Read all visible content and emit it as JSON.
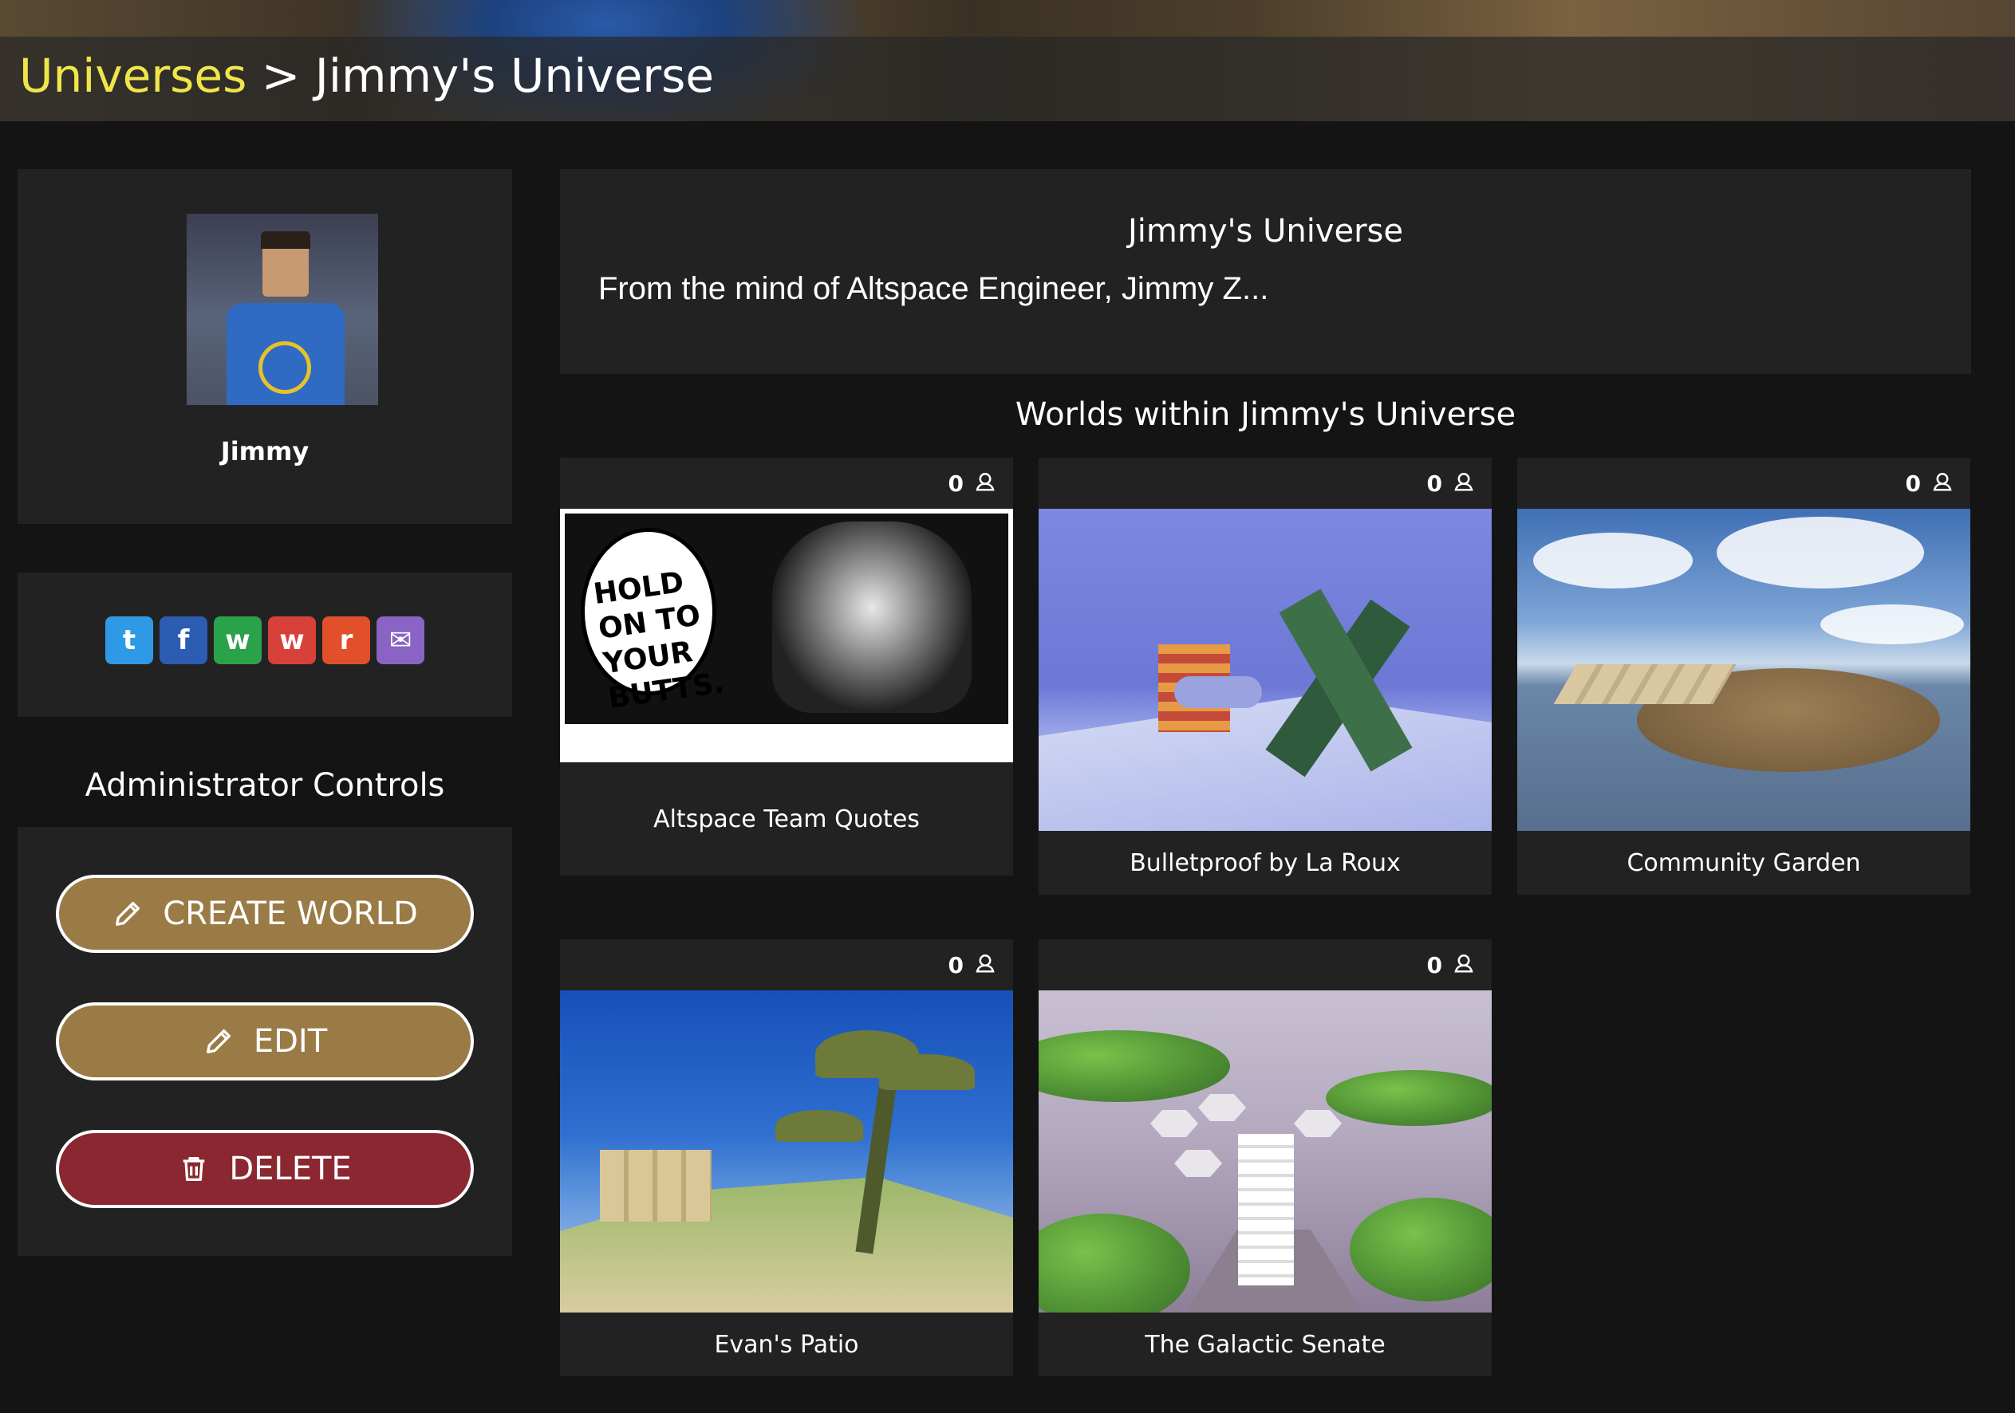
{
  "header": {
    "breadcrumb_root": "Universes",
    "breadcrumb_separator": ">",
    "breadcrumb_current": "Jimmy's Universe"
  },
  "profile": {
    "name": "Jimmy"
  },
  "share": {
    "items": [
      {
        "name": "twitter-icon",
        "glyph": "t",
        "color": "#2e9ae6"
      },
      {
        "name": "facebook-icon",
        "glyph": "f",
        "color": "#2d5cb3"
      },
      {
        "name": "wechat-icon",
        "glyph": "w",
        "color": "#2aa24a"
      },
      {
        "name": "weibo-icon",
        "glyph": "w",
        "color": "#d8413a"
      },
      {
        "name": "reddit-icon",
        "glyph": "r",
        "color": "#e2502b"
      },
      {
        "name": "email-icon",
        "glyph": "✉",
        "color": "#8a63c4"
      }
    ]
  },
  "admin": {
    "title": "Administrator Controls",
    "create_label": "CREATE WORLD",
    "edit_label": "EDIT",
    "delete_label": "DELETE",
    "colors": {
      "gold": "#9a7b45",
      "red": "#8a2730"
    }
  },
  "universe": {
    "title": "Jimmy's Universe",
    "description": "From the mind of Altspace Engineer, Jimmy Z..."
  },
  "worlds": {
    "heading": "Worlds within Jimmy's Universe",
    "items": [
      {
        "title": "Altspace Team Quotes",
        "count": "0",
        "thumb_text": "HOLD ON TO YOUR BUTTS."
      },
      {
        "title": "Bulletproof by La Roux",
        "count": "0"
      },
      {
        "title": "Community Garden",
        "count": "0"
      },
      {
        "title": "Evan's Patio",
        "count": "0"
      },
      {
        "title": "The Galactic Senate",
        "count": "0"
      }
    ]
  },
  "colors": {
    "accent_yellow": "#f0e64a",
    "background": "#141414",
    "panel": "#222222"
  }
}
